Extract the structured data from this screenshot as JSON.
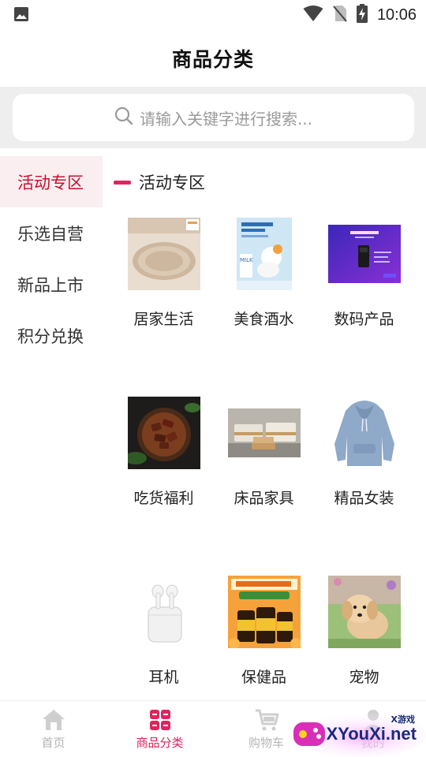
{
  "status_bar": {
    "time": "10:06",
    "icons": [
      "image-icon",
      "wifi-icon",
      "no-sim-icon",
      "battery-charging-icon"
    ]
  },
  "header": {
    "title": "商品分类"
  },
  "search": {
    "placeholder": "请输入关键字进行搜索..."
  },
  "sidebar": {
    "items": [
      {
        "label": "活动专区",
        "active": true
      },
      {
        "label": "乐选自营",
        "active": false
      },
      {
        "label": "新品上市",
        "active": false
      },
      {
        "label": "积分兑换",
        "active": false
      }
    ]
  },
  "section": {
    "title": "活动专区",
    "items": [
      {
        "label": "居家生活",
        "icon": "round-rug-image"
      },
      {
        "label": "美食酒水",
        "icon": "milk-drink-image"
      },
      {
        "label": "数码产品",
        "icon": "smartphone-image"
      },
      {
        "label": "吃货福利",
        "icon": "beef-jerky-image"
      },
      {
        "label": "床品家具",
        "icon": "sofa-image"
      },
      {
        "label": "精品女装",
        "icon": "hoodie-image"
      },
      {
        "label": "耳机",
        "icon": "earbuds-image"
      },
      {
        "label": "保健品",
        "icon": "vitamin-bottles-image"
      },
      {
        "label": "宠物",
        "icon": "puppy-image"
      }
    ]
  },
  "tabs": [
    {
      "label": "首页",
      "icon": "home-icon",
      "active": false
    },
    {
      "label": "商品分类",
      "icon": "category-icon",
      "active": true
    },
    {
      "label": "购物车",
      "icon": "cart-icon",
      "active": false
    },
    {
      "label": "我的",
      "icon": "user-icon",
      "active": false
    }
  ],
  "watermark": {
    "text": "XYouXi.net",
    "small": "X游戏"
  },
  "colors": {
    "accent": "#e0245e",
    "active_text": "#c8102e",
    "active_bg": "#fbeef0"
  }
}
